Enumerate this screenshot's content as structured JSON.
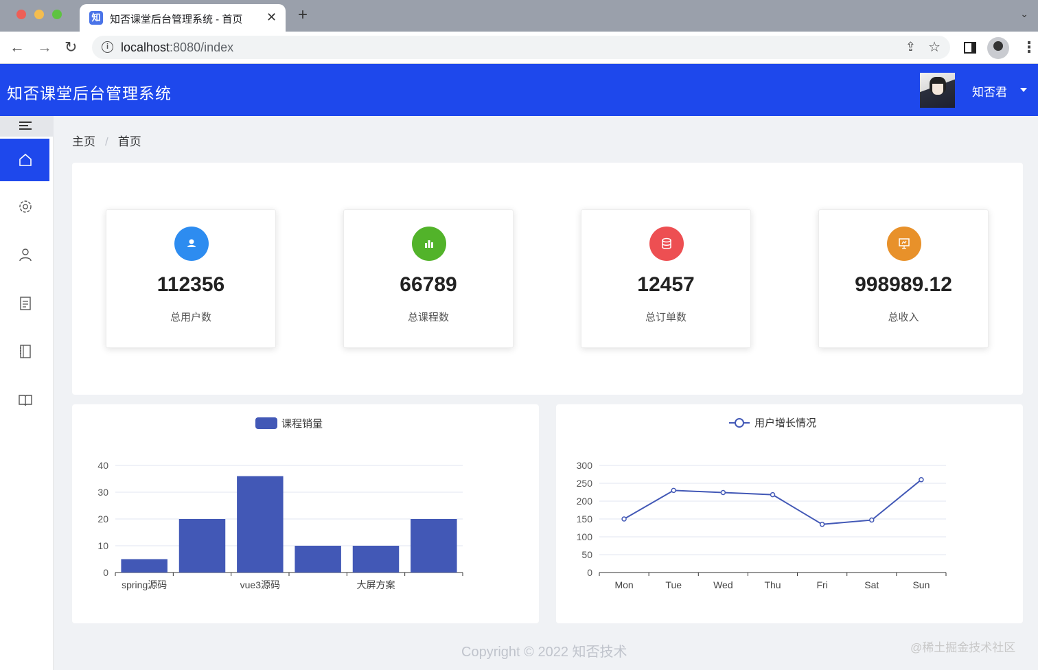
{
  "browser": {
    "tab_title": "知否课堂后台管理系统 - 首页",
    "tab_favicon": "知",
    "url_host": "localhost",
    "url_rest": ":8080/index"
  },
  "header": {
    "title": "知否课堂后台管理系统",
    "user_name": "知否君",
    "color": "#1e48ec"
  },
  "sidebar": {
    "items": [
      {
        "icon": "home-icon",
        "active": true
      },
      {
        "icon": "gear-icon",
        "active": false
      },
      {
        "icon": "user-icon",
        "active": false
      },
      {
        "icon": "document-icon",
        "active": false
      },
      {
        "icon": "notebook-icon",
        "active": false
      },
      {
        "icon": "book-icon",
        "active": false
      }
    ]
  },
  "breadcrumb": {
    "home": "主页",
    "separator": "/",
    "current": "首页"
  },
  "stats": [
    {
      "value": "112356",
      "label": "总用户数",
      "color": "#2d8cf0",
      "icon": "user-icon"
    },
    {
      "value": "66789",
      "label": "总课程数",
      "color": "#52b32a",
      "icon": "bar-chart-icon"
    },
    {
      "value": "12457",
      "label": "总订单数",
      "color": "#ed4f52",
      "icon": "database-icon"
    },
    {
      "value": "998989.12",
      "label": "总收入",
      "color": "#e8912a",
      "icon": "presentation-icon"
    }
  ],
  "chart_data": [
    {
      "type": "bar",
      "legend": "课程销量",
      "categories": [
        "spring源码",
        "",
        "vue3源码",
        "",
        "大屏方案",
        ""
      ],
      "values": [
        5,
        20,
        36,
        10,
        10,
        20
      ],
      "ylim": [
        0,
        40
      ],
      "yticks": [
        0,
        10,
        20,
        30,
        40
      ],
      "color": "#4258b6"
    },
    {
      "type": "line",
      "legend": "用户增长情况",
      "categories": [
        "Mon",
        "Tue",
        "Wed",
        "Thu",
        "Fri",
        "Sat",
        "Sun"
      ],
      "values": [
        150,
        230,
        224,
        218,
        135,
        147,
        260
      ],
      "ylim": [
        0,
        300
      ],
      "yticks": [
        0,
        50,
        100,
        150,
        200,
        250,
        300
      ],
      "color": "#4258b6"
    }
  ],
  "footer": "Copyright © 2022 知否技术",
  "watermark": "@稀土掘金技术社区"
}
